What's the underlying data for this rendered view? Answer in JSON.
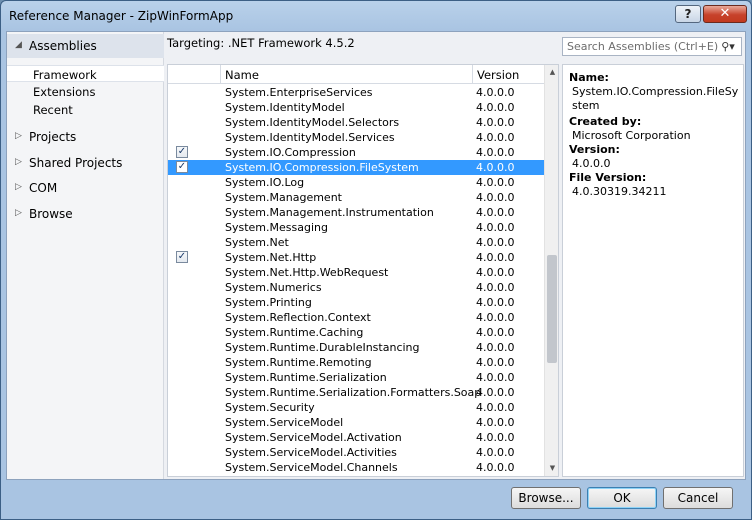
{
  "window": {
    "title": "Reference Manager - ZipWinFormApp",
    "help_label": "?",
    "close_label": "✕"
  },
  "nav": {
    "assemblies": {
      "arrow": "◢",
      "label": "Assemblies"
    },
    "sub_items": [
      {
        "label": "Framework",
        "selected": true
      },
      {
        "label": "Extensions",
        "selected": false
      },
      {
        "label": "Recent",
        "selected": false
      }
    ],
    "sections": [
      {
        "arrow": "▷",
        "label": "Projects"
      },
      {
        "arrow": "▷",
        "label": "Shared Projects"
      },
      {
        "arrow": "▷",
        "label": "COM"
      },
      {
        "arrow": "▷",
        "label": "Browse"
      }
    ]
  },
  "targeting": "Targeting: .NET Framework 4.5.2",
  "search": {
    "placeholder": "Search Assemblies (Ctrl+E)",
    "icon": "search-icon"
  },
  "list": {
    "headers": {
      "name": "Name",
      "version": "Version"
    },
    "rows": [
      {
        "name": "System.EnterpriseServices",
        "version": "4.0.0.0",
        "checked": false,
        "selected": false
      },
      {
        "name": "System.IdentityModel",
        "version": "4.0.0.0",
        "checked": false,
        "selected": false
      },
      {
        "name": "System.IdentityModel.Selectors",
        "version": "4.0.0.0",
        "checked": false,
        "selected": false
      },
      {
        "name": "System.IdentityModel.Services",
        "version": "4.0.0.0",
        "checked": false,
        "selected": false
      },
      {
        "name": "System.IO.Compression",
        "version": "4.0.0.0",
        "checked": true,
        "selected": false
      },
      {
        "name": "System.IO.Compression.FileSystem",
        "version": "4.0.0.0",
        "checked": true,
        "selected": true
      },
      {
        "name": "System.IO.Log",
        "version": "4.0.0.0",
        "checked": false,
        "selected": false
      },
      {
        "name": "System.Management",
        "version": "4.0.0.0",
        "checked": false,
        "selected": false
      },
      {
        "name": "System.Management.Instrumentation",
        "version": "4.0.0.0",
        "checked": false,
        "selected": false
      },
      {
        "name": "System.Messaging",
        "version": "4.0.0.0",
        "checked": false,
        "selected": false
      },
      {
        "name": "System.Net",
        "version": "4.0.0.0",
        "checked": false,
        "selected": false
      },
      {
        "name": "System.Net.Http",
        "version": "4.0.0.0",
        "checked": true,
        "selected": false
      },
      {
        "name": "System.Net.Http.WebRequest",
        "version": "4.0.0.0",
        "checked": false,
        "selected": false
      },
      {
        "name": "System.Numerics",
        "version": "4.0.0.0",
        "checked": false,
        "selected": false
      },
      {
        "name": "System.Printing",
        "version": "4.0.0.0",
        "checked": false,
        "selected": false
      },
      {
        "name": "System.Reflection.Context",
        "version": "4.0.0.0",
        "checked": false,
        "selected": false
      },
      {
        "name": "System.Runtime.Caching",
        "version": "4.0.0.0",
        "checked": false,
        "selected": false
      },
      {
        "name": "System.Runtime.DurableInstancing",
        "version": "4.0.0.0",
        "checked": false,
        "selected": false
      },
      {
        "name": "System.Runtime.Remoting",
        "version": "4.0.0.0",
        "checked": false,
        "selected": false
      },
      {
        "name": "System.Runtime.Serialization",
        "version": "4.0.0.0",
        "checked": false,
        "selected": false
      },
      {
        "name": "System.Runtime.Serialization.Formatters.Soap",
        "version": "4.0.0.0",
        "checked": false,
        "selected": false
      },
      {
        "name": "System.Security",
        "version": "4.0.0.0",
        "checked": false,
        "selected": false
      },
      {
        "name": "System.ServiceModel",
        "version": "4.0.0.0",
        "checked": false,
        "selected": false
      },
      {
        "name": "System.ServiceModel.Activation",
        "version": "4.0.0.0",
        "checked": false,
        "selected": false
      },
      {
        "name": "System.ServiceModel.Activities",
        "version": "4.0.0.0",
        "checked": false,
        "selected": false
      },
      {
        "name": "System.ServiceModel.Channels",
        "version": "4.0.0.0",
        "checked": false,
        "selected": false
      }
    ]
  },
  "details": {
    "name_label": "Name:",
    "name_value": "System.IO.Compression.FileSystem",
    "created_label": "Created by:",
    "created_value": "Microsoft Corporation",
    "version_label": "Version:",
    "version_value": "4.0.0.0",
    "file_version_label": "File Version:",
    "file_version_value": "4.0.30319.34211"
  },
  "buttons": {
    "browse": "Browse...",
    "ok": "OK",
    "cancel": "Cancel"
  }
}
